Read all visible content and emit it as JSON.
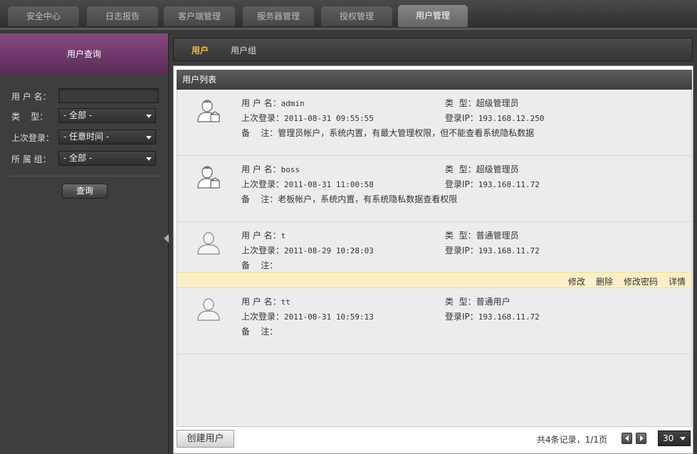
{
  "top_tabs": [
    {
      "label": "安全中心"
    },
    {
      "label": "日志报告"
    },
    {
      "label": "客户端管理"
    },
    {
      "label": "服务器管理"
    },
    {
      "label": "授权管理"
    },
    {
      "label": "用户管理",
      "active": true
    }
  ],
  "sidebar": {
    "title": "用户查询",
    "username_label": "用 户 名：",
    "username_value": "",
    "type_label": "类    型：",
    "type_value": "- 全部 -",
    "last_login_label": "上次登录：",
    "last_login_value": "- 任意时间 -",
    "group_label": "所 属 组：",
    "group_value": "- 全部 -",
    "query_button": "查询"
  },
  "sub_tabs": [
    {
      "label": "用户",
      "active": true
    },
    {
      "label": "用户组"
    }
  ],
  "list": {
    "title": "用户列表",
    "field_labels": {
      "username": "用 户 名：",
      "last_login": "上次登录：",
      "note": "备    注：",
      "type": "类  型：",
      "login_ip": "登录IP："
    },
    "users": [
      {
        "username": "admin",
        "last_login": "2011-08-31 09:55:55",
        "note": "管理员帐户，系统内置，有最大管理权限，但不能查看系统隐私数据",
        "type": "超级管理员",
        "login_ip": "193.168.12.250",
        "avatar": "admin-user-icon"
      },
      {
        "username": "boss",
        "last_login": "2011-08-31 11:00:58",
        "note": "老板帐户，系统内置，有系统隐私数据查看权限",
        "type": "超级管理员",
        "login_ip": "193.168.11.72",
        "avatar": "admin-user-icon"
      },
      {
        "username": "t",
        "last_login": "2011-08-29 10:28:03",
        "note": "",
        "type": "普通管理员",
        "login_ip": "193.168.11.72",
        "avatar": "user-icon"
      },
      {
        "username": "tt",
        "last_login": "2011-08-31 10:59:13",
        "note": "",
        "type": "普通用户",
        "login_ip": "193.168.11.72",
        "avatar": "user-icon"
      }
    ],
    "actions": {
      "edit": "修改",
      "delete": "删除",
      "change_password": "修改密码",
      "details": "详情"
    }
  },
  "footer": {
    "create_button": "创建用户",
    "record_info": "共4条记录，1/1页",
    "page_size": "30"
  }
}
